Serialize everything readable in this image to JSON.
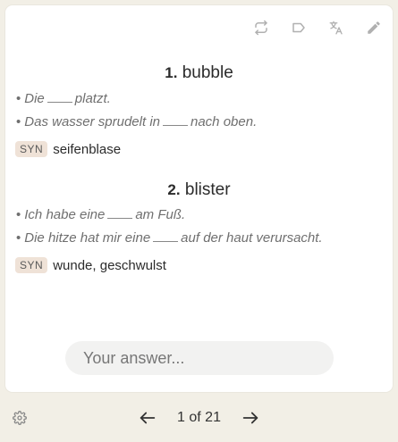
{
  "toolbar": {
    "icons": [
      "repeat-icon",
      "label-icon",
      "translate-icon",
      "edit-icon"
    ]
  },
  "entries": [
    {
      "number": "1.",
      "word": "bubble",
      "examples": [
        {
          "before": "Die",
          "after": "platzt."
        },
        {
          "before": "Das wasser sprudelt in",
          "after": "nach oben."
        }
      ],
      "syn_label": "SYN",
      "synonyms": "seifenblase"
    },
    {
      "number": "2.",
      "word": "blister",
      "examples": [
        {
          "before": "Ich habe eine",
          "after": "am Fuß."
        },
        {
          "before": "Die hitze hat mir eine",
          "after": "auf der haut verursacht."
        }
      ],
      "syn_label": "SYN",
      "synonyms": "wunde, geschwulst"
    }
  ],
  "answer": {
    "placeholder": "Your answer...",
    "value": ""
  },
  "pager": {
    "text": "1 of 21"
  },
  "colors": {
    "background": "#f2efe6",
    "card": "#ffffff",
    "syn_badge": "#efe2d7",
    "icon": "#b0b0b0"
  }
}
